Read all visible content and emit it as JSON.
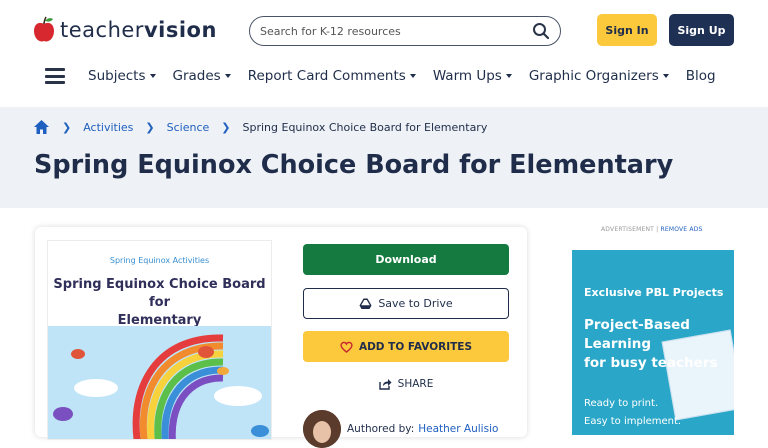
{
  "header": {
    "logo_text_light": "teacher",
    "logo_text_bold": "vision",
    "search_placeholder": "Search for K-12 resources",
    "signin_label": "Sign In",
    "signup_label": "Sign Up"
  },
  "nav": {
    "items": [
      {
        "label": "Subjects",
        "has_dropdown": true
      },
      {
        "label": "Grades",
        "has_dropdown": true
      },
      {
        "label": "Report Card Comments",
        "has_dropdown": true
      },
      {
        "label": "Warm Ups",
        "has_dropdown": true
      },
      {
        "label": "Graphic Organizers",
        "has_dropdown": true
      },
      {
        "label": "Blog",
        "has_dropdown": false
      }
    ]
  },
  "breadcrumb": {
    "items": [
      "Activities",
      "Science"
    ],
    "current": "Spring Equinox Choice Board for Elementary"
  },
  "page": {
    "title": "Spring Equinox Choice Board for Elementary"
  },
  "resource": {
    "thumb_kicker": "Spring Equinox Activities",
    "thumb_title_line1": "Spring Equinox Choice Board for",
    "thumb_title_line2": "Elementary",
    "download_label": "Download",
    "drive_label": "Save to Drive",
    "favorites_label": "ADD TO FAVORITES",
    "share_label": "SHARE",
    "author_label": "Authored by:",
    "author_name": "Heather Aulisio"
  },
  "ad": {
    "label": "ADVERTISEMENT |",
    "remove_label": "REMOVE ADS",
    "kicker": "Exclusive PBL Projects",
    "headline_line1": "Project-Based",
    "headline_line2": "Learning",
    "headline_line3": "for busy teachers",
    "sub_line1": "Ready to print.",
    "sub_line2": "Easy to implement."
  },
  "colors": {
    "brand_navy": "#1f2d4a",
    "accent_yellow": "#fcc83c",
    "download_green": "#157a3f",
    "link_blue": "#1f5fbf",
    "hero_bg": "#eef1f5",
    "ad_bg": "#2aa7c8"
  },
  "icons": {
    "logo": "apple-icon",
    "search": "search-icon",
    "menu": "hamburger-icon",
    "home": "home-icon",
    "drive": "google-drive-icon",
    "favorite": "heart-icon",
    "share": "share-icon"
  }
}
